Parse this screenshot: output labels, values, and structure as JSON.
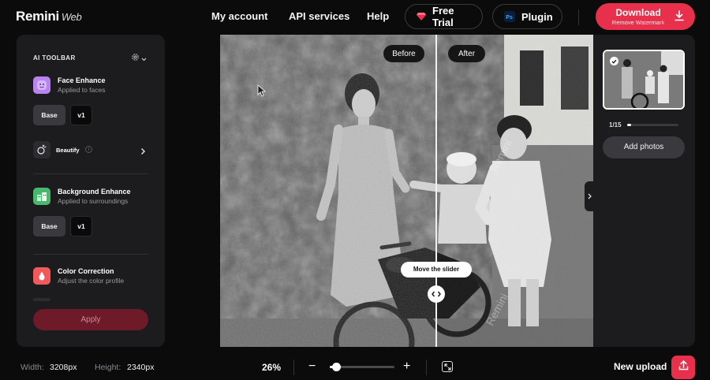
{
  "app": {
    "name": "Remini",
    "subtitle": "Web"
  },
  "nav": {
    "my_account": "My account",
    "api_services": "API services",
    "help": "Help",
    "free_trial": "Free Trial",
    "plugin": "Plugin",
    "download": "Download",
    "remove_watermark": "Remove Watermark"
  },
  "toolbar": {
    "title": "AI TOOLBAR",
    "face": {
      "title": "Face Enhance",
      "subtitle": "Applied to faces",
      "model": "Base",
      "version": "v1"
    },
    "beautify": {
      "label": "Beautify"
    },
    "background": {
      "title": "Background Enhance",
      "subtitle": "Applied to surroundings",
      "model": "Base",
      "version": "v1"
    },
    "color": {
      "title": "Color Correction",
      "subtitle": "Adjust the color profile"
    },
    "apply": "Apply"
  },
  "compare": {
    "before": "Before",
    "after": "After",
    "tip": "Move the slider",
    "watermark": "Remini"
  },
  "gallery": {
    "count": "1/15",
    "progress": 0.07,
    "add_photos": "Add photos"
  },
  "footer": {
    "width_label": "Width:",
    "width_value": "3208px",
    "height_label": "Height:",
    "height_value": "2340px",
    "zoom": "26%",
    "zoom_level": 0.1,
    "new_upload": "New upload"
  },
  "colors": {
    "accent": "#e8304d",
    "panel": "#1c1c1f",
    "background": "#0b0b0c"
  }
}
